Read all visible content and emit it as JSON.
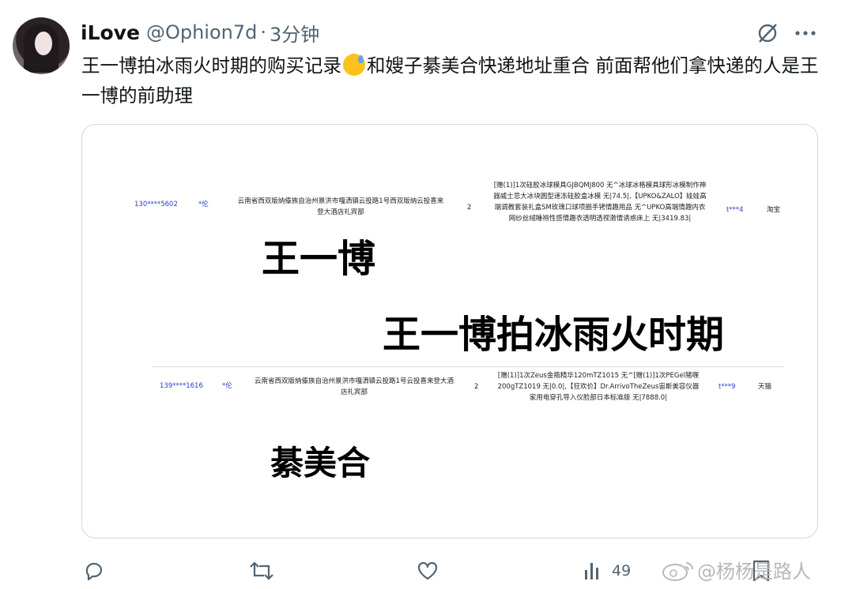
{
  "tweet": {
    "display_name": "iLove",
    "handle": "@Ophion7d",
    "separator": "·",
    "time": "3分钟",
    "text_part1": "王一博拍冰雨火时期的购买记录",
    "text_part2": "和嫂子綦美合快递地址重合 前面帮他们拿快递的人是王一博的前助理",
    "emoji": "grinning-face-with-sweat"
  },
  "image": {
    "row1": {
      "phone": "130****5602",
      "name": "*伦",
      "address": "云南省西双版纳傣族自治州景洪市嘎洒镇云投路1号西双版纳云投喜来登大酒店礼宾部",
      "qty": "2",
      "items": "[赠(1)]1次硅胶冰球模具GJBQMJ800 无^冰球冰格模具球形冰模制作神器威士忌大冰块圆型速冻硅胶盒冰模 无|74.5|,【UPKO&ZALO】娃娃高端调教套装礼盒SM玫瑰口球项圈手铐情趣用品 无^UPKO高端情趣内衣网纱丝绒睡袍性感情趣衣透明透视激情诱惑床上 无|3419.83|",
      "buyer": "t***4",
      "platform": "淘宝"
    },
    "row2": {
      "phone": "139****1616",
      "name": "*伦",
      "address": "云南省西双版纳傣族自治州景洪市嘎洒镇云投路1号云投喜来登大酒店礼宾部",
      "qty": "2",
      "items": "[赠(1)]1次Zeus金瓶精华120mTZ1015 无^[赠(1)]1次PEGel猪喱200gTZ1019 无|0.0|,【狂欢价】Dr.ArrivoTheZeus宙斯美容仪器家用电穿孔导入仪脸部日本标准版 无|7888.0|",
      "buyer": "t***9",
      "platform": "天猫"
    },
    "caption1": "王一博",
    "caption2": "王一博拍冰雨火时期",
    "caption3": "綦美合"
  },
  "actions": {
    "views": "49",
    "icons": [
      "reply-icon",
      "retweet-icon",
      "like-icon",
      "views-icon",
      "bookmark-icon"
    ]
  },
  "watermark": {
    "text": "@杨杨是路人"
  },
  "colors": {
    "text": "#0f1419",
    "secondary": "#536471",
    "link_blue": "#2b3ec9",
    "border": "#cfd9de"
  }
}
